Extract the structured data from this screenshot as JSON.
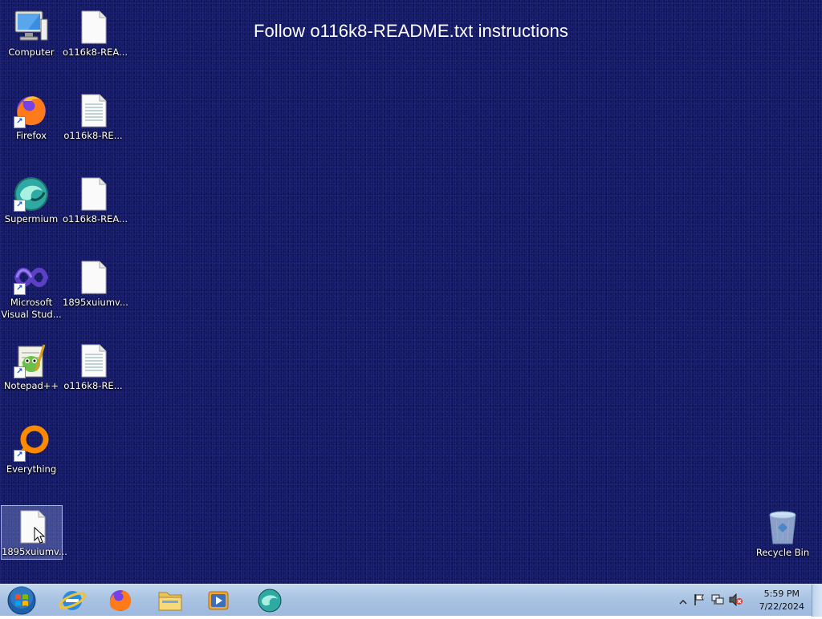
{
  "desktop": {
    "banner": "Follow o116k8-README.txt instructions",
    "icons": [
      {
        "label": "Computer"
      },
      {
        "label": "o116k8-REA..."
      },
      {
        "label": "Firefox"
      },
      {
        "label": "o116k8-RE..."
      },
      {
        "label": "Supermium"
      },
      {
        "label": "o116k8-REA..."
      },
      {
        "label": "Microsoft Visual Stud..."
      },
      {
        "label": "1895xuiumv..."
      },
      {
        "label": "Notepad++"
      },
      {
        "label": "o116k8-RE..."
      },
      {
        "label": "Everything"
      },
      {
        "label": "1895xuiumv..."
      },
      {
        "label": "Recycle Bin"
      }
    ]
  },
  "taskbar": {
    "pinned": [
      "Internet Explorer",
      "Firefox",
      "Windows Explorer",
      "Windows Media Player",
      "Supermium"
    ],
    "clock": {
      "time": "5:59 PM",
      "date": "7/22/2024"
    }
  },
  "colors": {
    "desktop_bg": "#141a6e",
    "taskbar": "#a9c3e3"
  }
}
